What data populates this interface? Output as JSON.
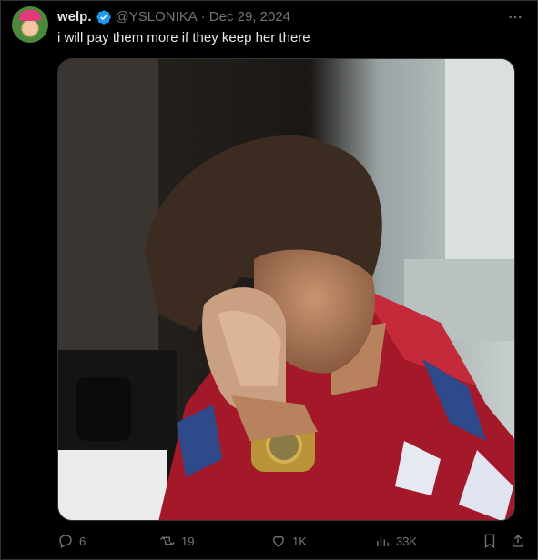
{
  "tweet": {
    "author_name": "welp.",
    "handle": "@YSLONIKA",
    "separator": "·",
    "date": "Dec 29, 2024",
    "text": "i will pay them more if they keep her there",
    "verified": true
  },
  "actions": {
    "replies": "6",
    "retweets": "19",
    "likes": "1K",
    "views": "33K"
  },
  "icons": {
    "reply": "reply-icon",
    "retweet": "retweet-icon",
    "like": "heart-icon",
    "views": "views-bar-chart-icon",
    "bookmark": "bookmark-icon",
    "share": "share-icon",
    "more": "more-dots-icon",
    "verified": "verified-badge-icon"
  },
  "colors": {
    "background": "#000000",
    "text_primary": "#e7e9ea",
    "text_secondary": "#71767b",
    "verified_blue": "#1d9bf0"
  }
}
